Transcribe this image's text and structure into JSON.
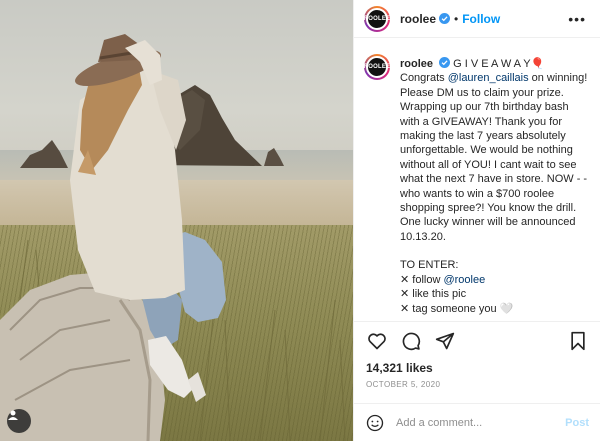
{
  "header": {
    "avatar_text": "ROOLEE",
    "username": "roolee",
    "dot": "•",
    "follow_label": "Follow",
    "more_label": "•••"
  },
  "caption": {
    "avatar_text": "ROOLEE",
    "username": "roolee",
    "title": "G I V E A W A Y",
    "title_emoji": "🎈",
    "congrats_prefix": "Congrats ",
    "mention_winner": "@lauren_caillais",
    "congrats_suffix": " on winning! Please DM us to claim your prize. Wrapping up our 7th birthday bash with a GIVEAWAY! Thank you for making the last 7 years absolutely unforgettable. We would be nothing without all of YOU! I cant wait to see what the next 7 have in store. NOW - - who wants to win a $700 roolee shopping spree?! You know the drill. One lucky winner will be announced 10.13.20.",
    "to_enter": "TO ENTER:",
    "step1_prefix": "✕ follow ",
    "step1_mention": "@roolee",
    "step2": "✕ like this pic",
    "step3": "✕ tag someone you 🤍"
  },
  "actions": {
    "like_icon": "heart-icon",
    "comment_icon": "comment-icon",
    "share_icon": "share-icon",
    "save_icon": "bookmark-icon"
  },
  "likes": "14,321 likes",
  "date": "OCTOBER 5, 2020",
  "comment_box": {
    "placeholder": "Add a comment...",
    "post_label": "Post"
  },
  "colors": {
    "accent": "#0095f6",
    "post_disabled": "#b2dffc",
    "muted": "#8e8e8e",
    "verified": "#3897f0"
  }
}
